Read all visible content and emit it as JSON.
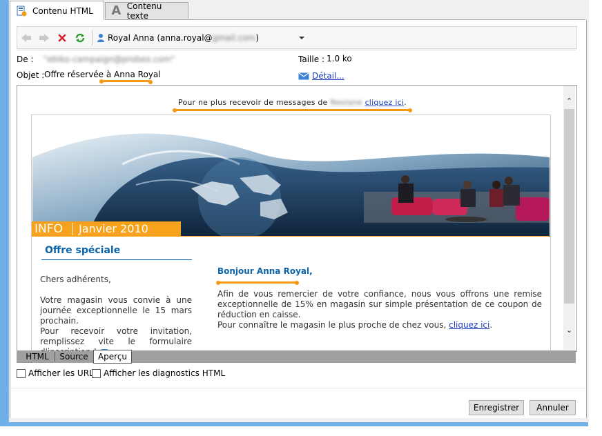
{
  "tabs": [
    {
      "label": "Contenu HTML",
      "icon": "html-content-icon",
      "active": true
    },
    {
      "label": "Contenu texte",
      "icon": "text-content-icon",
      "active": false
    }
  ],
  "toolbar": {
    "recipient_name": "Royal Anna (anna.royal@",
    "recipient_blurred": "gmail.com",
    "recipient_suffix": ")"
  },
  "header": {
    "from_label": "De :",
    "from_value": "\"ebiko-campaign@probeo.com\"",
    "subject_label": "Objet :",
    "subject_value": "Offre réservée à Anna Royal",
    "size_label": "Taille :",
    "size_value": "1.0 ko",
    "detail_link": "Détail..."
  },
  "preview": {
    "unsubscribe_prefix": "Pour ne plus recevoir de messages de",
    "unsubscribe_blurred": "Neolane",
    "unsubscribe_link": "cliquez ici",
    "unsubscribe_end": ".",
    "banner_info": "INFO",
    "banner_date": "Janvier 2010",
    "offer_title": "Offre spéciale",
    "left_greeting": "Chers adhérents,",
    "left_para1": "Votre magasin vous convie à une journée exceptionnelle le 15 mars prochain.",
    "left_para2": "Pour recevoir votre invitation, remplissez vite le formulaire d'inscription !",
    "right_greeting": "Bonjour Anna Royal,",
    "right_para1": "Afin de vous remercier de votre confiance, nous vous offrons une remise exceptionnelle de 15% en magasin sur simple présentation de ce coupon de réduction en caisse.",
    "right_para2_prefix": "Pour connaître le magasin le plus proche de chez vous,",
    "right_para2_link": "cliquez ici",
    "right_para2_end": "."
  },
  "bottom_tabs": [
    {
      "label": "HTML",
      "active": false
    },
    {
      "label": "Source",
      "active": false
    },
    {
      "label": "Aperçu",
      "active": true
    }
  ],
  "options": {
    "show_urls": "Afficher les URL",
    "show_diagnostics": "Afficher les diagnostics HTML"
  },
  "buttons": {
    "save": "Enregistrer",
    "cancel": "Annuler"
  },
  "colors": {
    "accent_orange": "#f39a12",
    "title_blue": "#0b64a9",
    "link_blue": "#1a3fbf"
  }
}
